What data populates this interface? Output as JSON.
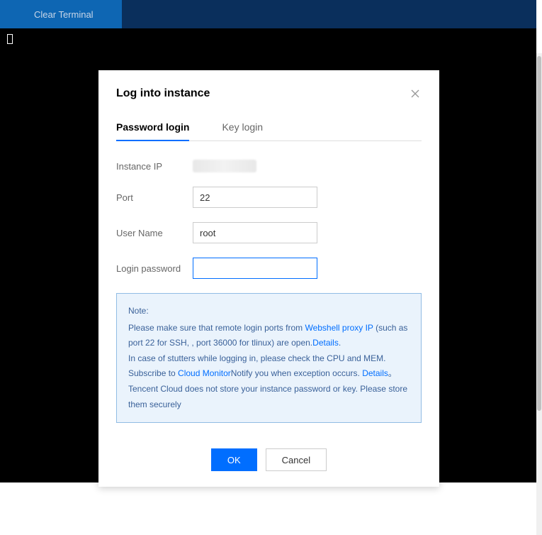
{
  "header": {
    "clear_terminal": "Clear Terminal"
  },
  "modal": {
    "title": "Log into instance",
    "tabs": {
      "password": "Password login",
      "key": "Key login"
    },
    "form": {
      "instance_ip_label": "Instance IP",
      "port_label": "Port",
      "port_value": "22",
      "username_label": "User Name",
      "username_value": "root",
      "password_label": "Login password",
      "password_value": ""
    },
    "note": {
      "title": "Note:",
      "line1_a": "Please make sure that remote login ports from ",
      "line1_link": "Webshell proxy IP",
      "line1_b": " (such as port 22 for SSH, , port 36000 for tlinux) are open.",
      "line1_details": "Details",
      "line1_end": ".",
      "line2": "In case of stutters while logging in, please check the CPU and MEM. Subscribe to ",
      "line2_link": "Cloud Monitor",
      "line2_b": "Notify you when exception occurs. ",
      "line2_details": "Details",
      "line2_end": "。",
      "line3": "Tencent Cloud does not store your instance password or key. Please store them securely"
    },
    "footer": {
      "ok": "OK",
      "cancel": "Cancel"
    }
  }
}
